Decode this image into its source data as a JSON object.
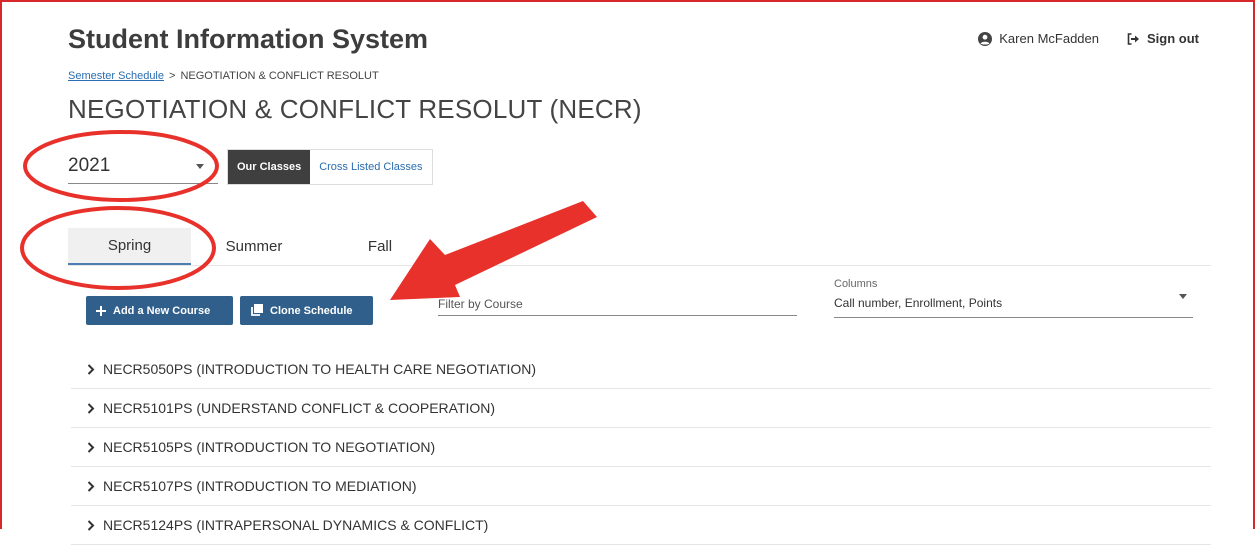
{
  "header": {
    "app_title": "Student Information System",
    "user_name": "Karen McFadden",
    "sign_out_label": "Sign out"
  },
  "breadcrumb": {
    "parent_label": "Semester Schedule",
    "separator": ">",
    "current_label": "NEGOTIATION & CONFLICT RESOLUT"
  },
  "page_title": "NEGOTIATION & CONFLICT RESOLUT (NECR)",
  "year_select": {
    "value": "2021"
  },
  "class_toggle": {
    "options": [
      {
        "label": "Our Classes",
        "active": true
      },
      {
        "label": "Cross Listed Classes",
        "active": false
      }
    ]
  },
  "term_tabs": [
    {
      "label": "Spring",
      "active": true
    },
    {
      "label": "Summer",
      "active": false
    },
    {
      "label": "Fall",
      "active": false
    }
  ],
  "actions": {
    "add_label": "Add a New Course",
    "clone_label": "Clone Schedule"
  },
  "filter": {
    "placeholder": "Filter by Course",
    "value": ""
  },
  "columns_select": {
    "label": "Columns",
    "value": "Call number, Enrollment, Points"
  },
  "courses": [
    {
      "label": "NECR5050PS (INTRODUCTION TO HEALTH CARE NEGOTIATION)"
    },
    {
      "label": "NECR5101PS (UNDERSTAND CONFLICT & COOPERATION)"
    },
    {
      "label": "NECR5105PS (INTRODUCTION TO NEGOTIATION)"
    },
    {
      "label": "NECR5107PS (INTRODUCTION TO MEDIATION)"
    },
    {
      "label": "NECR5124PS (INTRAPERSONAL DYNAMICS & CONFLICT)"
    }
  ],
  "icons": {
    "user": "user-circle-icon",
    "sign_out": "sign-out-icon",
    "add": "plus-icon",
    "clone": "copy-icon",
    "dropdown": "caret-down-icon",
    "expand": "chevron-right-icon"
  },
  "colors": {
    "primary_button": "#2f5f8a",
    "link": "#2a6db0",
    "active_toggle": "#3f3f3f",
    "annotation": "#e8312b",
    "frame_border": "#d62828"
  }
}
